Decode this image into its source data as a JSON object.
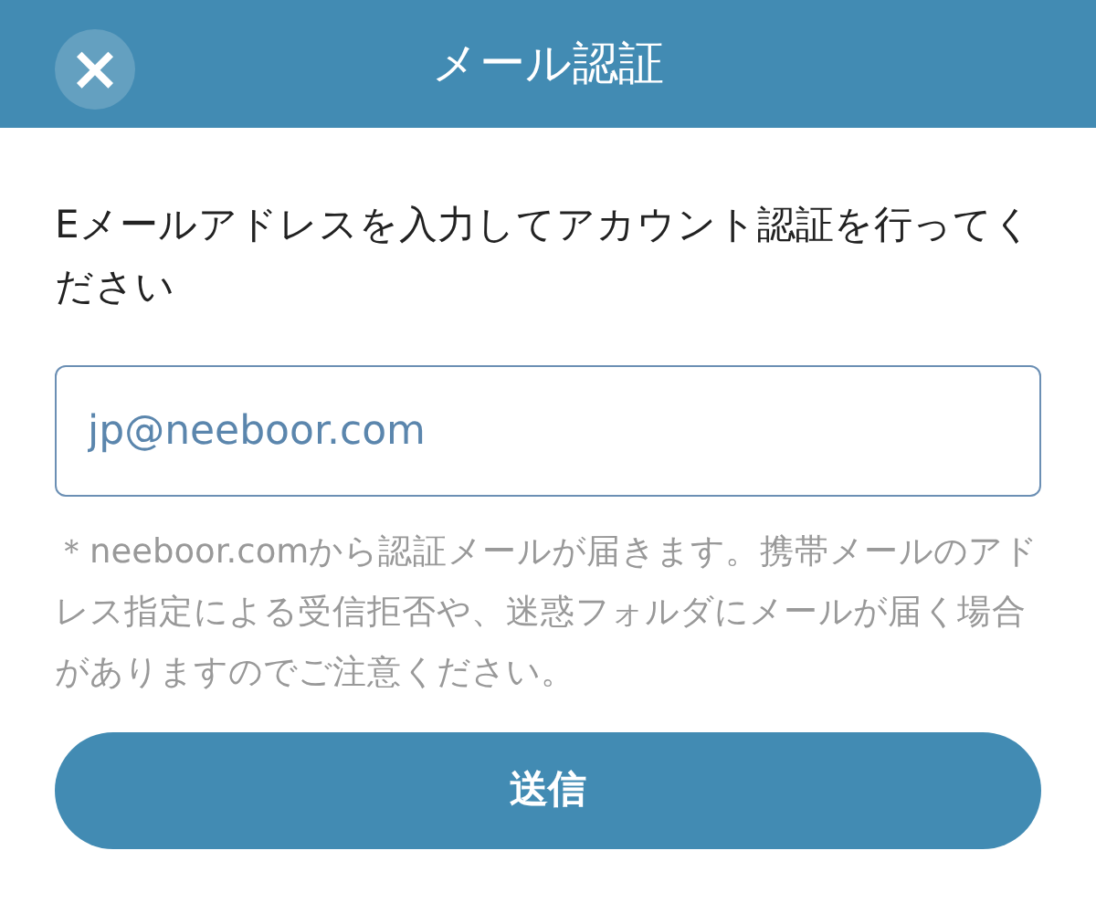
{
  "header": {
    "title": "メール認証",
    "close_icon": "×"
  },
  "instruction": "Eメールアドレスを入力してアカウント認証を行ってください",
  "email_field": {
    "placeholder": "jp@neeboor.com"
  },
  "note": "＊neeboor.comから認証メールが届きます。携帯メールのアドレス指定による受信拒否や、迷惑フォルダにメールが届く場合がありますのでご注意ください。",
  "submit_button": "送信"
}
